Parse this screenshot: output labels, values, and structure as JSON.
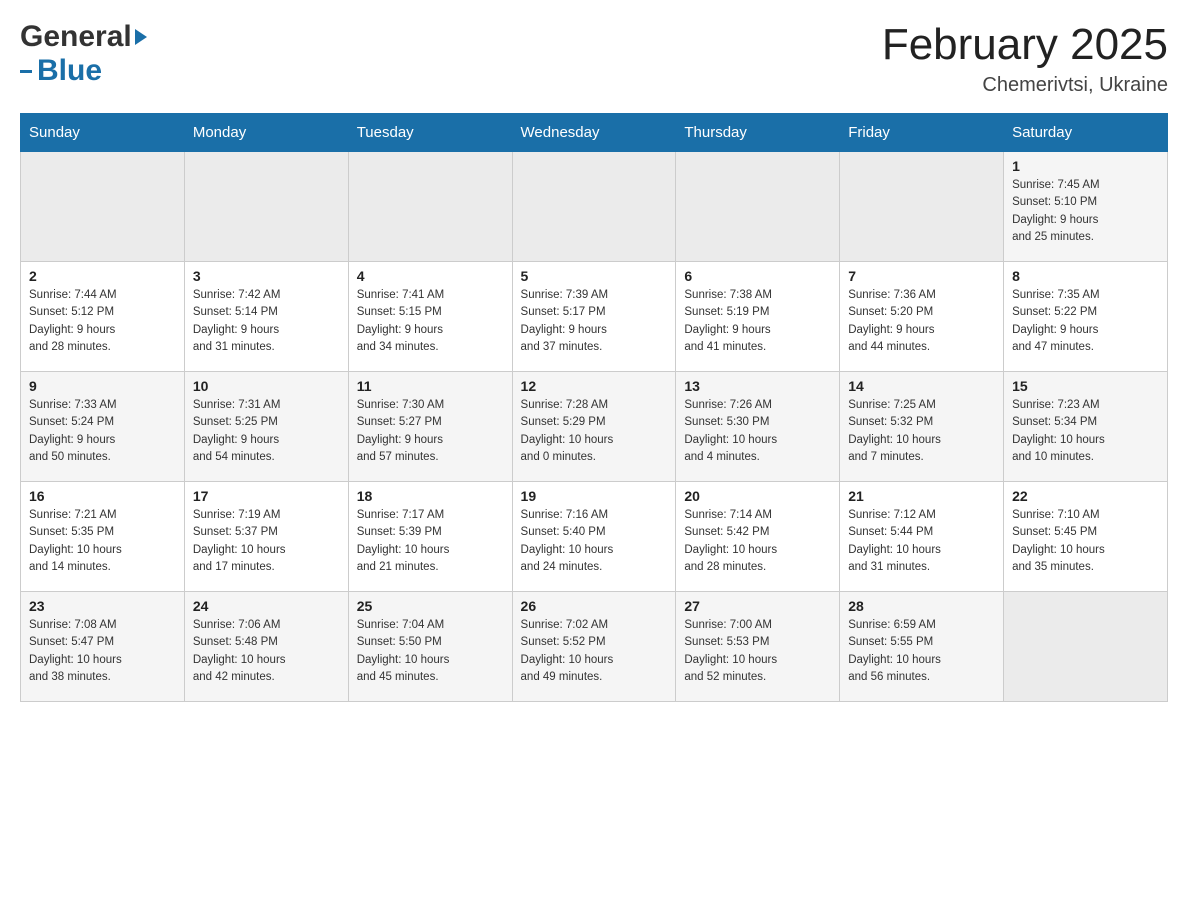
{
  "header": {
    "logo": {
      "general": "General",
      "blue": "Blue",
      "triangle": "▶"
    },
    "title": "February 2025",
    "location": "Chemerivtsi, Ukraine"
  },
  "calendar": {
    "days_of_week": [
      "Sunday",
      "Monday",
      "Tuesday",
      "Wednesday",
      "Thursday",
      "Friday",
      "Saturday"
    ],
    "weeks": [
      {
        "id": "week1",
        "days": [
          {
            "date": "",
            "info": ""
          },
          {
            "date": "",
            "info": ""
          },
          {
            "date": "",
            "info": ""
          },
          {
            "date": "",
            "info": ""
          },
          {
            "date": "",
            "info": ""
          },
          {
            "date": "",
            "info": ""
          },
          {
            "date": "1",
            "info": "Sunrise: 7:45 AM\nSunset: 5:10 PM\nDaylight: 9 hours\nand 25 minutes."
          }
        ]
      },
      {
        "id": "week2",
        "days": [
          {
            "date": "2",
            "info": "Sunrise: 7:44 AM\nSunset: 5:12 PM\nDaylight: 9 hours\nand 28 minutes."
          },
          {
            "date": "3",
            "info": "Sunrise: 7:42 AM\nSunset: 5:14 PM\nDaylight: 9 hours\nand 31 minutes."
          },
          {
            "date": "4",
            "info": "Sunrise: 7:41 AM\nSunset: 5:15 PM\nDaylight: 9 hours\nand 34 minutes."
          },
          {
            "date": "5",
            "info": "Sunrise: 7:39 AM\nSunset: 5:17 PM\nDaylight: 9 hours\nand 37 minutes."
          },
          {
            "date": "6",
            "info": "Sunrise: 7:38 AM\nSunset: 5:19 PM\nDaylight: 9 hours\nand 41 minutes."
          },
          {
            "date": "7",
            "info": "Sunrise: 7:36 AM\nSunset: 5:20 PM\nDaylight: 9 hours\nand 44 minutes."
          },
          {
            "date": "8",
            "info": "Sunrise: 7:35 AM\nSunset: 5:22 PM\nDaylight: 9 hours\nand 47 minutes."
          }
        ]
      },
      {
        "id": "week3",
        "days": [
          {
            "date": "9",
            "info": "Sunrise: 7:33 AM\nSunset: 5:24 PM\nDaylight: 9 hours\nand 50 minutes."
          },
          {
            "date": "10",
            "info": "Sunrise: 7:31 AM\nSunset: 5:25 PM\nDaylight: 9 hours\nand 54 minutes."
          },
          {
            "date": "11",
            "info": "Sunrise: 7:30 AM\nSunset: 5:27 PM\nDaylight: 9 hours\nand 57 minutes."
          },
          {
            "date": "12",
            "info": "Sunrise: 7:28 AM\nSunset: 5:29 PM\nDaylight: 10 hours\nand 0 minutes."
          },
          {
            "date": "13",
            "info": "Sunrise: 7:26 AM\nSunset: 5:30 PM\nDaylight: 10 hours\nand 4 minutes."
          },
          {
            "date": "14",
            "info": "Sunrise: 7:25 AM\nSunset: 5:32 PM\nDaylight: 10 hours\nand 7 minutes."
          },
          {
            "date": "15",
            "info": "Sunrise: 7:23 AM\nSunset: 5:34 PM\nDaylight: 10 hours\nand 10 minutes."
          }
        ]
      },
      {
        "id": "week4",
        "days": [
          {
            "date": "16",
            "info": "Sunrise: 7:21 AM\nSunset: 5:35 PM\nDaylight: 10 hours\nand 14 minutes."
          },
          {
            "date": "17",
            "info": "Sunrise: 7:19 AM\nSunset: 5:37 PM\nDaylight: 10 hours\nand 17 minutes."
          },
          {
            "date": "18",
            "info": "Sunrise: 7:17 AM\nSunset: 5:39 PM\nDaylight: 10 hours\nand 21 minutes."
          },
          {
            "date": "19",
            "info": "Sunrise: 7:16 AM\nSunset: 5:40 PM\nDaylight: 10 hours\nand 24 minutes."
          },
          {
            "date": "20",
            "info": "Sunrise: 7:14 AM\nSunset: 5:42 PM\nDaylight: 10 hours\nand 28 minutes."
          },
          {
            "date": "21",
            "info": "Sunrise: 7:12 AM\nSunset: 5:44 PM\nDaylight: 10 hours\nand 31 minutes."
          },
          {
            "date": "22",
            "info": "Sunrise: 7:10 AM\nSunset: 5:45 PM\nDaylight: 10 hours\nand 35 minutes."
          }
        ]
      },
      {
        "id": "week5",
        "days": [
          {
            "date": "23",
            "info": "Sunrise: 7:08 AM\nSunset: 5:47 PM\nDaylight: 10 hours\nand 38 minutes."
          },
          {
            "date": "24",
            "info": "Sunrise: 7:06 AM\nSunset: 5:48 PM\nDaylight: 10 hours\nand 42 minutes."
          },
          {
            "date": "25",
            "info": "Sunrise: 7:04 AM\nSunset: 5:50 PM\nDaylight: 10 hours\nand 45 minutes."
          },
          {
            "date": "26",
            "info": "Sunrise: 7:02 AM\nSunset: 5:52 PM\nDaylight: 10 hours\nand 49 minutes."
          },
          {
            "date": "27",
            "info": "Sunrise: 7:00 AM\nSunset: 5:53 PM\nDaylight: 10 hours\nand 52 minutes."
          },
          {
            "date": "28",
            "info": "Sunrise: 6:59 AM\nSunset: 5:55 PM\nDaylight: 10 hours\nand 56 minutes."
          },
          {
            "date": "",
            "info": ""
          }
        ]
      }
    ]
  }
}
